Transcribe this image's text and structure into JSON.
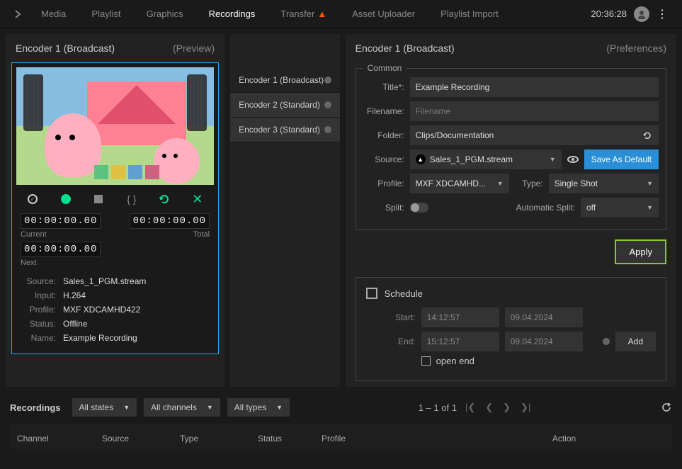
{
  "topbar": {
    "tabs": [
      "Media",
      "Playlist",
      "Graphics",
      "Recordings",
      "Transfer",
      "Asset Uploader",
      "Playlist Import"
    ],
    "active_tab": "Recordings",
    "warning_on": "Transfer",
    "clock": "20:36:28"
  },
  "preview": {
    "title": "Encoder 1 (Broadcast)",
    "subtitle": "(Preview)",
    "tc_current": "00:00:00.00",
    "tc_current_label": "Current",
    "tc_total": "00:00:00.00",
    "tc_total_label": "Total",
    "tc_next": "00:00:00.00",
    "tc_next_label": "Next",
    "info": {
      "source_label": "Source:",
      "source": "Sales_1_PGM.stream",
      "input_label": "Input:",
      "input": "H.264",
      "profile_label": "Profile:",
      "profile": "MXF XDCAMHD422",
      "status_label": "Status:",
      "status": "Offline",
      "name_label": "Name:",
      "name": "Example Recording"
    }
  },
  "encoders": [
    {
      "label": "Encoder 1 (Broadcast)"
    },
    {
      "label": "Encoder 2 (Standard)"
    },
    {
      "label": "Encoder 3 (Standard)"
    }
  ],
  "prefs": {
    "title": "Encoder 1 (Broadcast)",
    "subtitle": "(Preferences)",
    "common_legend": "Common",
    "title_label": "Title*:",
    "title_val": "Example Recording",
    "filename_label": "Filename:",
    "filename_placeholder": "Filename",
    "folder_label": "Folder:",
    "folder_val": "Clips/Documentation",
    "source_label": "Source:",
    "source_val": "Sales_1_PGM.stream",
    "save_default": "Save As Default",
    "profile_label": "Profile:",
    "profile_val": "MXF XDCAMHD...",
    "type_label": "Type:",
    "type_val": "Single Shot",
    "split_label": "Split:",
    "autosplit_label": "Automatic Split:",
    "autosplit_val": "off",
    "apply": "Apply"
  },
  "schedule": {
    "title": "Schedule",
    "start_label": "Start:",
    "start_time": "14:12:57",
    "start_date": "09.04.2024",
    "end_label": "End:",
    "end_time": "15:12:57",
    "end_date": "09.04.2024",
    "open_end": "open end",
    "add": "Add"
  },
  "recordings": {
    "title": "Recordings",
    "filter_states": "All states",
    "filter_channels": "All channels",
    "filter_types": "All types",
    "pager": "1 – 1 of 1",
    "cols": [
      "Channel",
      "Source",
      "Type",
      "Status",
      "Profile",
      "Action"
    ]
  }
}
